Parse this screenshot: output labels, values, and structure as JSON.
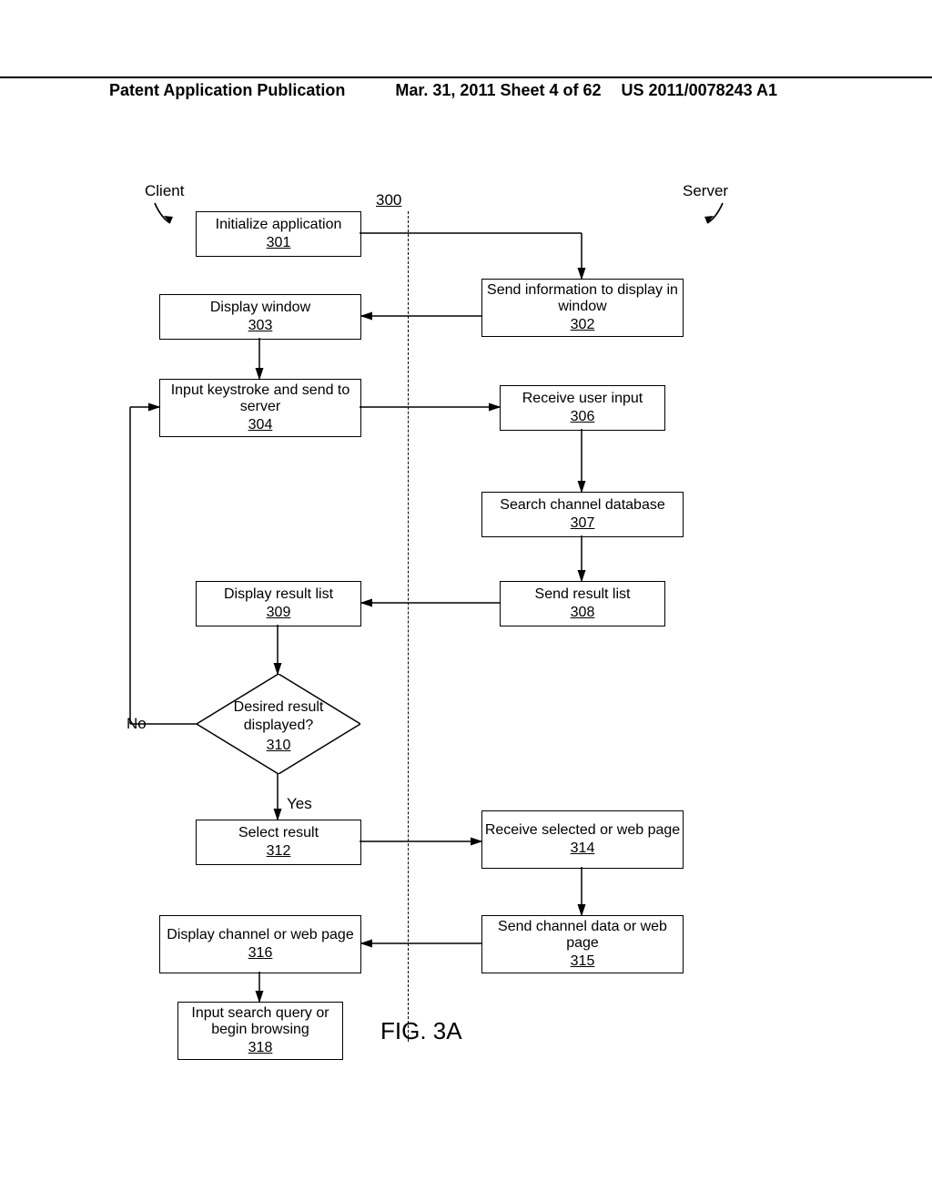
{
  "header": {
    "left": "Patent Application Publication",
    "mid": "Mar. 31, 2011  Sheet 4 of 62",
    "right": "US 2011/0078243 A1"
  },
  "labels": {
    "client": "Client",
    "server": "Server",
    "figRef": "300",
    "no": "No",
    "yes": "Yes",
    "figure": "FIG. 3A"
  },
  "boxes": {
    "b301": {
      "text": "Initialize application",
      "ref": "301"
    },
    "b302": {
      "text": "Send information to display in window",
      "ref": "302"
    },
    "b303": {
      "text": "Display window",
      "ref": "303"
    },
    "b304": {
      "text": "Input keystroke and send to server",
      "ref": "304"
    },
    "b306": {
      "text": "Receive user input",
      "ref": "306"
    },
    "b307": {
      "text": "Search channel database",
      "ref": "307"
    },
    "b308": {
      "text": "Send result list",
      "ref": "308"
    },
    "b309": {
      "text": "Display result list",
      "ref": "309"
    },
    "b310": {
      "line1": "Desired result",
      "line2": "displayed?",
      "ref": "310"
    },
    "b312": {
      "text": "Select result",
      "ref": "312"
    },
    "b314": {
      "text": "Receive selected or web page",
      "ref": "314"
    },
    "b315": {
      "text": "Send channel data or web page",
      "ref": "315"
    },
    "b316": {
      "text": "Display channel or web page",
      "ref": "316"
    },
    "b318": {
      "text": "Input search query or begin browsing",
      "ref": "318"
    }
  }
}
